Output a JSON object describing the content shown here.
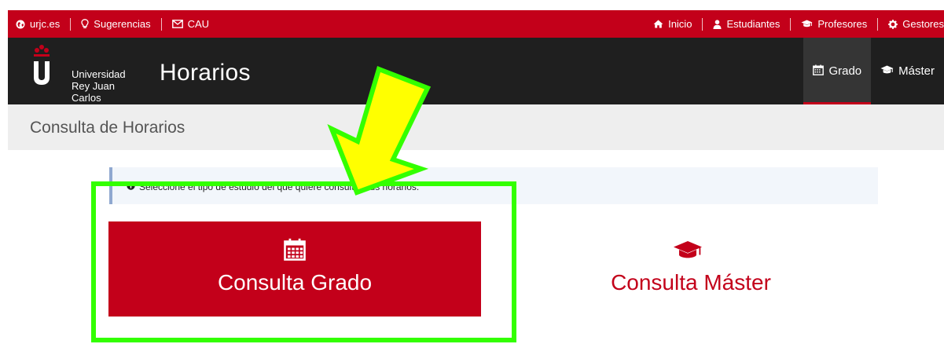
{
  "topbar": {
    "left": [
      {
        "label": "urjc.es",
        "icon": "globe-icon"
      },
      {
        "label": "Sugerencias",
        "icon": "lightbulb-icon"
      },
      {
        "label": "CAU",
        "icon": "envelope-icon"
      }
    ],
    "right": [
      {
        "label": "Inicio",
        "icon": "home-icon"
      },
      {
        "label": "Estudiantes",
        "icon": "user-icon"
      },
      {
        "label": "Profesores",
        "icon": "graduation-cap-icon"
      },
      {
        "label": "Gestores",
        "icon": "gear-icon"
      }
    ]
  },
  "header": {
    "logo_line1": "Universidad",
    "logo_line2": "Rey Juan Carlos",
    "app_title": "Horarios",
    "nav": [
      {
        "label": "Grado",
        "icon": "calendar-icon",
        "active": true
      },
      {
        "label": "Máster",
        "icon": "graduation-cap-icon",
        "active": false
      }
    ]
  },
  "page": {
    "title": "Consulta de Horarios",
    "info": "Seleccione el tipo de estudio del que quiere consultar sus horarios."
  },
  "cards": {
    "grado": {
      "label": "Consulta Grado",
      "icon": "calendar-icon"
    },
    "master": {
      "label": "Consulta Máster",
      "icon": "graduation-cap-icon"
    }
  },
  "colors": {
    "brand_red": "#c3001a",
    "header_dark": "#1f1f1f",
    "title_band": "#eeeeee",
    "annotation_green": "#33ff00",
    "annotation_arrow_fill": "#ffff00"
  }
}
